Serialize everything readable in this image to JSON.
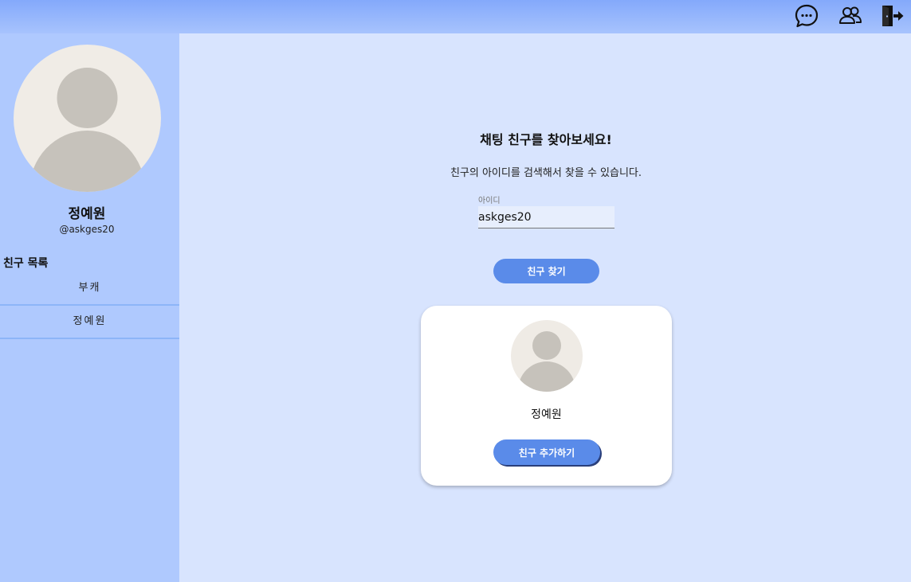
{
  "header": {
    "icons": [
      "chat-icon",
      "friends-icon",
      "logout-icon"
    ]
  },
  "profile": {
    "name": "정예원",
    "id": "@askges20"
  },
  "friends": {
    "title": "친구 목록",
    "items": [
      "부캐",
      "정예원"
    ]
  },
  "search": {
    "title": "채팅 친구를 찾아보세요!",
    "description": "친구의 아이디를 검색해서 찾을 수 있습니다.",
    "label": "아이디",
    "value": "askges20",
    "button": "친구 찾기"
  },
  "result": {
    "name": "정예원",
    "button": "친구 추가하기"
  },
  "colors": {
    "accent": "#5a8be9",
    "sidebar": "#afc9fe",
    "background": "#d8e4fe"
  }
}
